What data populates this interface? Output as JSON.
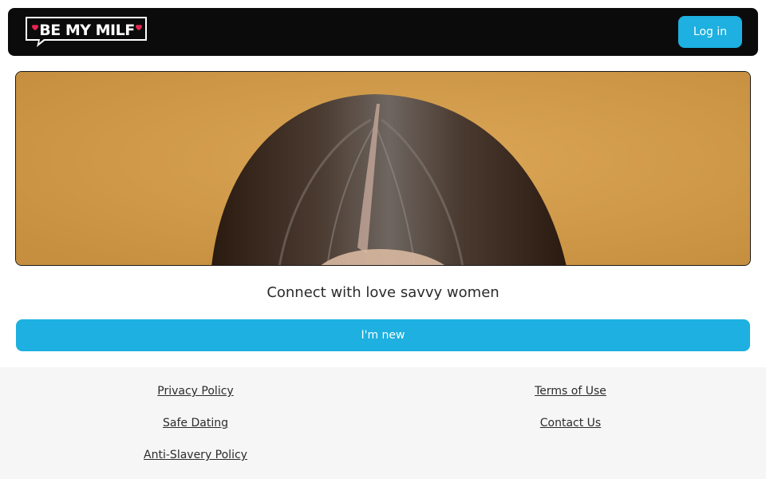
{
  "header": {
    "logo_text": "BE MY MILF",
    "login_label": "Log in"
  },
  "hero": {
    "image_icon": "hero-photo"
  },
  "main": {
    "tagline": "Connect with love savvy women",
    "new_button_label": "I'm new"
  },
  "footer": {
    "left_links": [
      "Privacy Policy",
      "Safe Dating",
      "Anti-Slavery Policy"
    ],
    "right_links": [
      "Terms of Use",
      "Contact Us"
    ]
  },
  "colors": {
    "accent": "#1db0e0",
    "header_bg": "#0b0b0b",
    "hero_bg": "#d19a48",
    "heart": "#e8254f",
    "footer_bg": "#f6f6f6"
  }
}
